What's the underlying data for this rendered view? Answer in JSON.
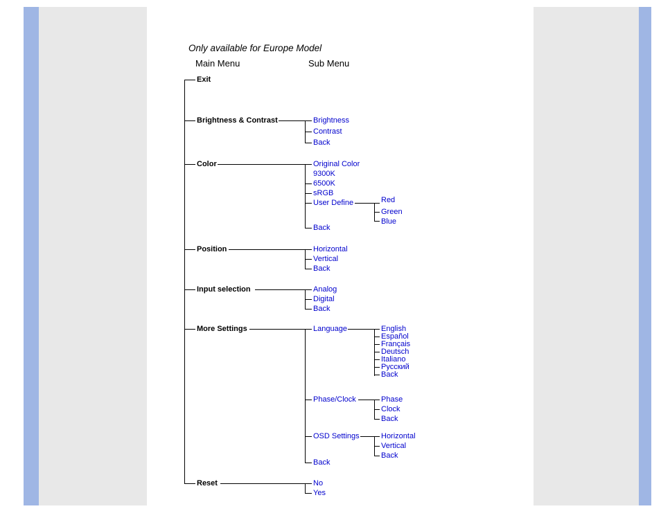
{
  "title": "Only available for Europe Model",
  "headers": {
    "main": "Main Menu",
    "sub": "Sub Menu"
  },
  "main_items": {
    "exit": "Exit",
    "brightness_contrast": "Brightness & Contrast",
    "color": "Color",
    "position": "Position",
    "input_selection": "Input selection",
    "more_settings": "More Settings",
    "reset": "Reset"
  },
  "sub": {
    "bc": {
      "brightness": "Brightness",
      "contrast": "Contrast",
      "back": "Back"
    },
    "color": {
      "original": "Original Color",
      "k9300": "9300K",
      "k6500": "6500K",
      "srgb": "sRGB",
      "user_define": "User Define",
      "back": "Back"
    },
    "color_user": {
      "red": "Red",
      "green": "Green",
      "blue": "Blue"
    },
    "position": {
      "horizontal": "Horizontal",
      "vertical": "Vertical",
      "back": "Back"
    },
    "input": {
      "analog": "Analog",
      "digital": "Digital",
      "back": "Back"
    },
    "more": {
      "language": "Language",
      "phase_clock": "Phase/Clock",
      "osd": "OSD Settings",
      "back": "Back"
    },
    "language": {
      "en": "English",
      "es": "Español",
      "fr": "Français",
      "de": "Deutsch",
      "it": "Italiano",
      "ru": "Русский",
      "back": "Back"
    },
    "phase_clock": {
      "phase": "Phase",
      "clock": "Clock",
      "back": "Back"
    },
    "osd": {
      "horizontal": "Horizontal",
      "vertical": "Vertical",
      "back": "Back"
    },
    "reset": {
      "no": "No",
      "yes": "Yes"
    }
  }
}
